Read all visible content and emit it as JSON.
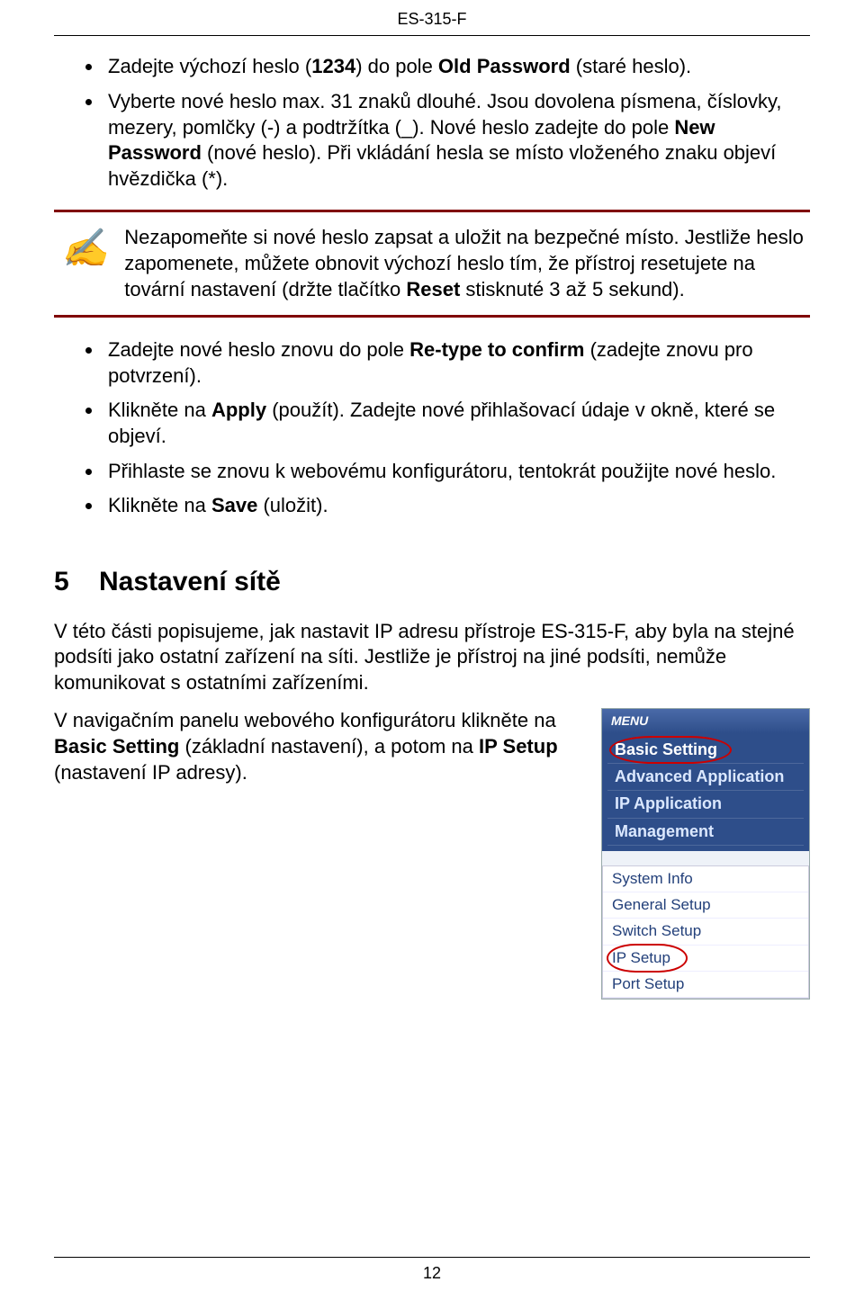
{
  "header": {
    "model": "ES-315-F"
  },
  "bullets1": [
    {
      "pre": "Zadejte výchozí heslo (",
      "b": "1234",
      "post": ") do pole ",
      "b2": "Old Password",
      "post2": " (staré heslo)."
    },
    {
      "text": "Vyberte nové heslo max. 31 znaků dlouhé. Jsou dovolena písmena, číslovky, mezery, pomlčky (-) a podtržítka (_). Nové heslo zadejte do pole ",
      "b": "New Password",
      "post": " (nové heslo). Při vkládání hesla se místo vloženého znaku objeví hvězdička (*)."
    }
  ],
  "note": {
    "text": "Nezapomeňte si nové heslo zapsat a uložit na bezpečné místo. Jestliže heslo zapomenete, můžete obnovit výchozí heslo tím, že přístroj resetujete na tovární nastavení (držte tlačítko ",
    "b": "Reset",
    "post": " stisknuté 3 až 5 sekund)."
  },
  "bullets2": [
    {
      "pre": "Zadejte nové heslo znovu do pole ",
      "b": "Re-type to confirm",
      "post": " (zadejte znovu pro potvrzení)."
    },
    {
      "pre": "Klikněte na ",
      "b": "Apply",
      "post": " (použít). Zadejte nové přihlašovací údaje v okně, které se objeví."
    },
    {
      "text": "Přihlaste se znovu k webovému konfigurátoru, tentokrát použijte nové heslo."
    },
    {
      "pre": "Klikněte na ",
      "b": "Save",
      "post": " (uložit)."
    }
  ],
  "section5": {
    "num": "5",
    "title": "Nastavení sítě",
    "p1": "V této části popisujeme, jak nastavit IP adresu přístroje ES-315-F, aby byla na stejné podsíti jako ostatní zařízení na síti. Jestliže je přístroj na jiné podsíti, nemůže komunikovat s ostatními zařízeními.",
    "p2a": "V navigačním panelu webového konfigurátoru klikněte na ",
    "p2b": "Basic Setting",
    "p2c": " (základní nastavení), a potom na ",
    "p2d": "IP Setup",
    "p2e": " (nastavení IP adresy)."
  },
  "menu": {
    "header": "MENU",
    "links": [
      "Basic Setting",
      "Advanced Application",
      "IP Application",
      "Management"
    ],
    "sub": [
      "System Info",
      "General Setup",
      "Switch Setup",
      "IP Setup",
      "Port Setup"
    ]
  },
  "footer": {
    "page": "12"
  }
}
